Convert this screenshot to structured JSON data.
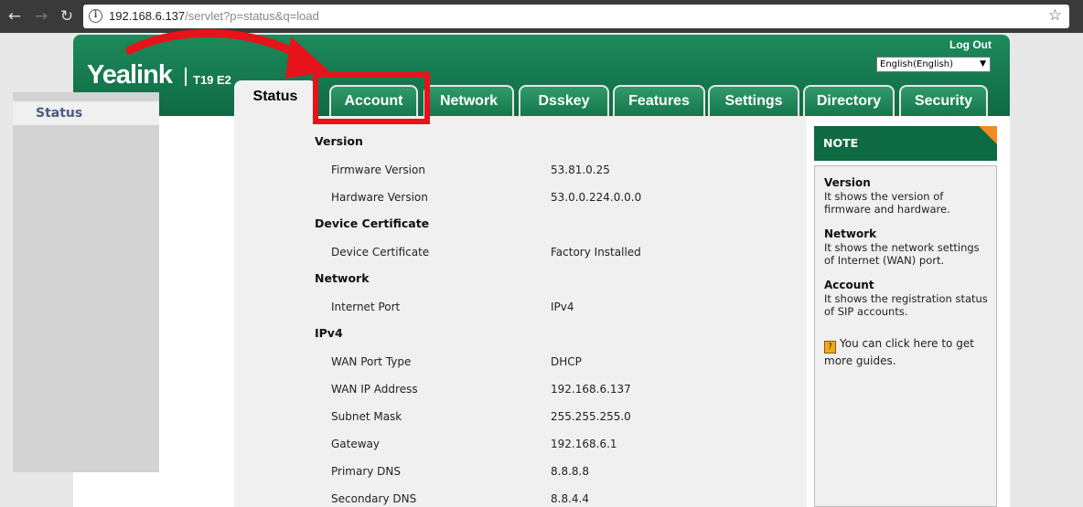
{
  "browser": {
    "url_host": "192.168.6.137",
    "url_path": "/servlet?p=status&q=load"
  },
  "header": {
    "logo": "Yealink",
    "model": "T19 E2",
    "logout": "Log Out",
    "language": "English(English)"
  },
  "tabs": [
    "Status",
    "Account",
    "Network",
    "Dsskey",
    "Features",
    "Settings",
    "Directory",
    "Security"
  ],
  "sidebar": {
    "items": [
      {
        "label": "Status"
      }
    ]
  },
  "status": {
    "version_title": "Version",
    "firmware_label": "Firmware Version",
    "firmware_value": "53.81.0.25",
    "hardware_label": "Hardware Version",
    "hardware_value": "53.0.0.224.0.0.0",
    "cert_title": "Device Certificate",
    "cert_label": "Device Certificate",
    "cert_value": "Factory Installed",
    "network_title": "Network",
    "port_label": "Internet Port",
    "port_value": "IPv4",
    "ipv4_title": "IPv4",
    "wan_type_label": "WAN Port Type",
    "wan_type_value": "DHCP",
    "wan_ip_label": "WAN IP Address",
    "wan_ip_value": "192.168.6.137",
    "mask_label": "Subnet Mask",
    "mask_value": "255.255.255.0",
    "gateway_label": "Gateway",
    "gateway_value": "192.168.6.1",
    "dns1_label": "Primary DNS",
    "dns1_value": "8.8.8.8",
    "dns2_label": "Secondary DNS",
    "dns2_value": "8.8.4.4"
  },
  "note": {
    "title": "NOTE",
    "version_title": "Version",
    "version_text": "It shows the version of firmware and hardware.",
    "network_title": "Network",
    "network_text": "It shows the network settings of Internet (WAN) port.",
    "account_title": "Account",
    "account_text": "It shows the registration status of SIP accounts.",
    "guide_text": "You can click here to get more guides."
  },
  "colors": {
    "brand_green": "#0e6a42",
    "highlight_red": "#e8121a",
    "note_corner": "#f28c1e"
  }
}
